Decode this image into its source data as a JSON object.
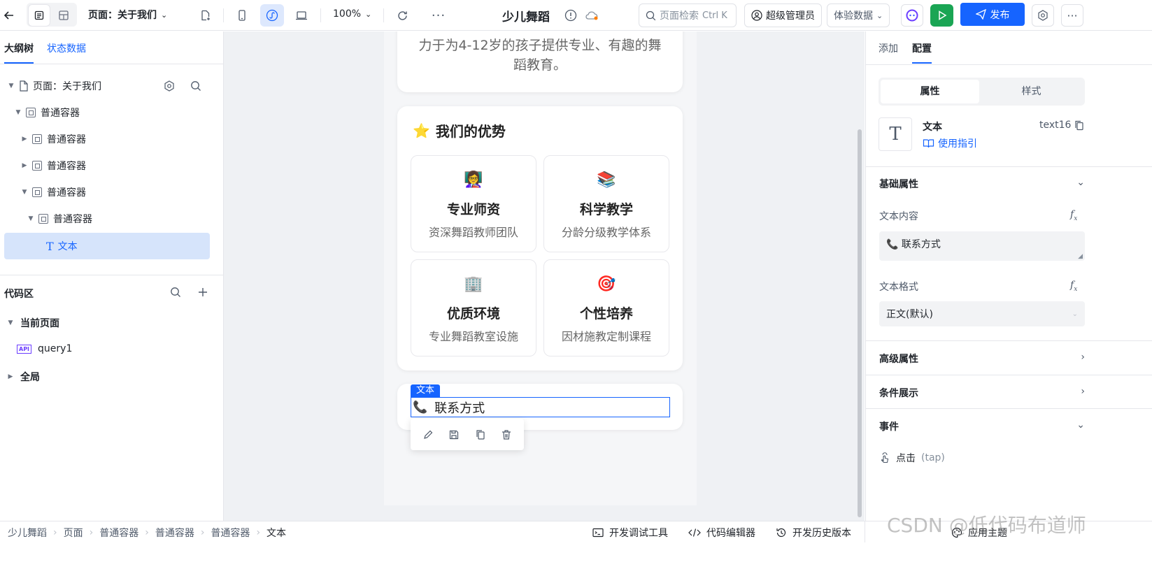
{
  "topbar": {
    "page_selector": "页面：关于我们",
    "zoom": "100%",
    "app_title": "少儿舞蹈",
    "search_placeholder": "页面检索",
    "search_shortcut": "Ctrl K",
    "user_role": "超级管理员",
    "data_mode": "体验数据",
    "publish_label": "发布"
  },
  "left": {
    "tabs": [
      "大纲树",
      "状态数据"
    ],
    "tree": [
      {
        "label": "页面：关于我们"
      },
      {
        "label": "普通容器"
      },
      {
        "label": "普通容器"
      },
      {
        "label": "普通容器"
      },
      {
        "label": "普通容器"
      },
      {
        "label": "普通容器"
      },
      {
        "label": "文本"
      }
    ],
    "code_title": "代码区",
    "current_page": "当前页面",
    "query_badge": "API",
    "query_name": "query1",
    "global": "全局"
  },
  "canvas": {
    "intro_text": "力于为4-12岁的孩子提供专业、有趣的舞蹈教育。",
    "adv_title": "我们的优势",
    "adv_icon": "⭐",
    "advantages": [
      {
        "emoji": "👩‍🏫",
        "title": "专业师资",
        "desc": "资深舞蹈教师团队"
      },
      {
        "emoji": "📚",
        "title": "科学教学",
        "desc": "分龄分级教学体系"
      },
      {
        "emoji": "🏢",
        "title": "优质环境",
        "desc": "专业舞蹈教室设施"
      },
      {
        "emoji": "🎯",
        "title": "个性培养",
        "desc": "因材施教定制课程"
      }
    ],
    "selected_tag": "文本",
    "contact_icon": "📞",
    "contact_text": "联系方式"
  },
  "right": {
    "tabs": [
      "添加",
      "配置"
    ],
    "segment": [
      "属性",
      "样式"
    ],
    "comp_name": "文本",
    "comp_id": "text16",
    "guide_link": "使用指引",
    "basic_props": "基础属性",
    "text_content_label": "文本内容",
    "text_content_value": "📞 联系方式",
    "text_format_label": "文本格式",
    "text_format_value": "正文(默认)",
    "advanced": "高级属性",
    "condition": "条件展示",
    "events": "事件",
    "event_item": "点击",
    "event_item_code": "(tap)"
  },
  "footer": {
    "breadcrumb": [
      "少儿舞蹈",
      "页面",
      "普通容器",
      "普通容器",
      "普通容器",
      "文本"
    ],
    "debug": "开发调试工具",
    "code_editor": "代码编辑器",
    "history": "开发历史版本",
    "theme": "应用主题",
    "watermark": "CSDN @低代码布道师"
  },
  "colors": {
    "primary": "#1664ff",
    "selected_bg": "#d6e4fb",
    "run_green": "#1aa554"
  }
}
